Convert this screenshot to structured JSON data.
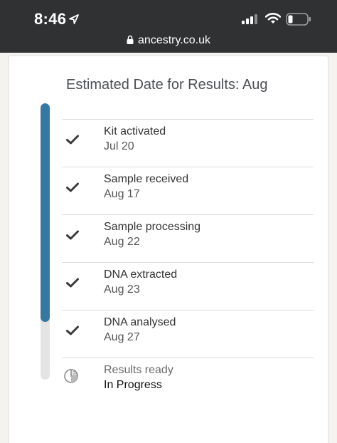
{
  "status_bar": {
    "time": "8:46",
    "icons": [
      "location-arrow-icon",
      "cellular-signal-icon",
      "wifi-icon",
      "battery-icon"
    ]
  },
  "browser": {
    "url": "ancestry.co.uk",
    "icon": "lock-icon"
  },
  "card": {
    "title": "Estimated Date for Results: Aug",
    "progress_fraction": 0.79,
    "steps": [
      {
        "label": "Kit activated",
        "date": "Jul 20",
        "status": "done",
        "icon": "checkmark-icon"
      },
      {
        "label": "Sample received",
        "date": "Aug 17",
        "status": "done",
        "icon": "checkmark-icon"
      },
      {
        "label": "Sample processing",
        "date": "Aug 22",
        "status": "done",
        "icon": "checkmark-icon"
      },
      {
        "label": "DNA extracted",
        "date": "Aug 23",
        "status": "done",
        "icon": "checkmark-icon"
      },
      {
        "label": "DNA analysed",
        "date": "Aug 27",
        "status": "done",
        "icon": "checkmark-icon"
      },
      {
        "label": "Results ready",
        "date": "In Progress",
        "status": "pending",
        "icon": "pie-chart-icon"
      }
    ]
  },
  "colors": {
    "status_bar_bg": "#2f3132",
    "progress_fill": "#3579a3",
    "progress_track": "#e4e4e4"
  }
}
